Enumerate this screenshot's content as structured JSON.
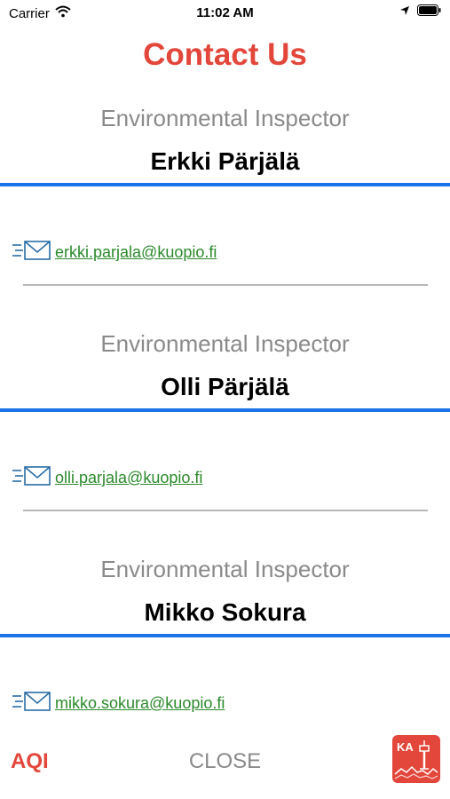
{
  "status_bar": {
    "carrier": "Carrier",
    "time": "11:02 AM",
    "icons": [
      "wifi-icon",
      "location-arrow-icon",
      "battery-icon"
    ]
  },
  "page": {
    "title": "Contact Us"
  },
  "contacts": [
    {
      "role": "Environmental Inspector",
      "name": "Erkki Pärjälä",
      "email": "erkki.parjala@kuopio.fi"
    },
    {
      "role": "Environmental Inspector",
      "name": "Olli Pärjälä",
      "email": "olli.parjala@kuopio.fi"
    },
    {
      "role": "Environmental Inspector",
      "name": "Mikko Sokura",
      "email": "mikko.sokura@kuopio.fi"
    }
  ],
  "footer": {
    "aqi_label": "AQI",
    "close_label": "CLOSE",
    "logo_text": "KA"
  },
  "colors": {
    "accent_red": "#e3463a",
    "line_blue": "#1a73e8",
    "link_green": "#2b8a2b",
    "muted_gray": "#8a8a8a",
    "divider_gray": "#b7b7b7"
  }
}
